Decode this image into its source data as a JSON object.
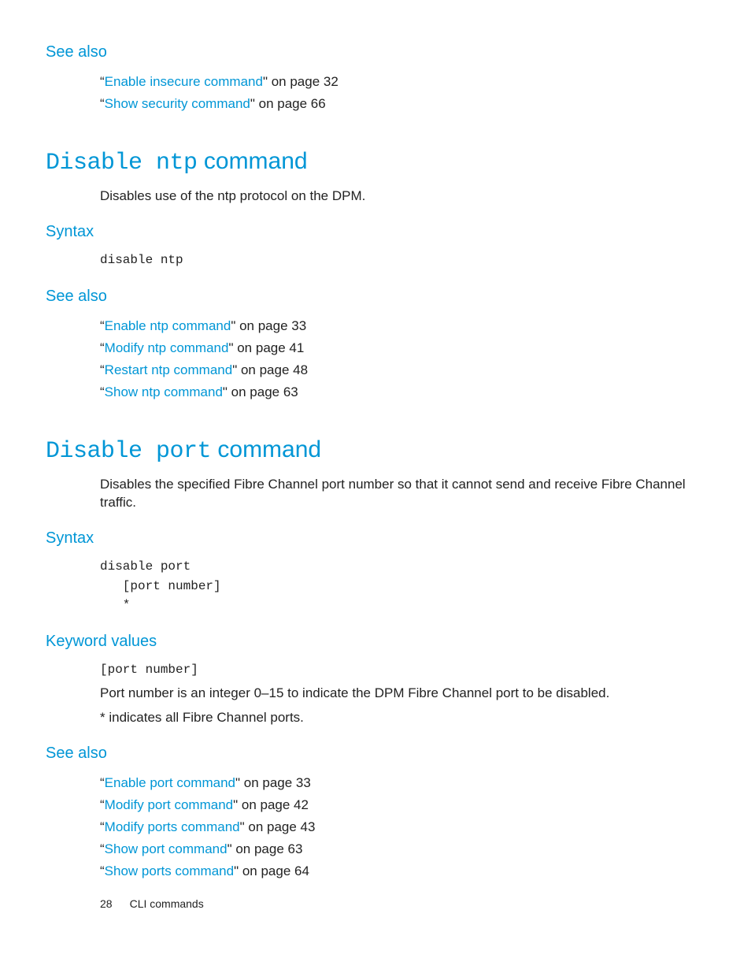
{
  "section1": {
    "heading": "See also",
    "refs": [
      {
        "link": "Enable insecure command",
        "tail": "\" on page 32"
      },
      {
        "link": "Show security command",
        "tail": "\" on page 66"
      }
    ]
  },
  "section2": {
    "titleMono": "Disable ntp",
    "titleRest": " command",
    "desc": "Disables use of the ntp protocol on the DPM.",
    "syntaxHead": "Syntax",
    "syntaxCode": "disable ntp",
    "seeAlsoHead": "See also",
    "refs": [
      {
        "link": "Enable ntp command",
        "tail": "\" on page 33"
      },
      {
        "link": "Modify ntp command",
        "tail": "\" on page 41"
      },
      {
        "link": "Restart ntp command",
        "tail": "\" on page 48"
      },
      {
        "link": "Show ntp command",
        "tail": "\" on page 63"
      }
    ]
  },
  "section3": {
    "titleMono": "Disable port",
    "titleRest": " command",
    "desc": "Disables the specified Fibre Channel port number so that it cannot send and receive Fibre Channel traffic.",
    "syntaxHead": "Syntax",
    "syntaxCode": "disable port\n   [port number]\n   *",
    "kvHead": "Keyword values",
    "kvCode": "[port number]",
    "kvDesc1": "Port number is an integer 0–15 to indicate the DPM Fibre Channel port to be disabled.",
    "kvDesc2": "* indicates all Fibre Channel ports.",
    "seeAlsoHead": "See also",
    "refs": [
      {
        "link": "Enable port command",
        "tail": "\" on page 33"
      },
      {
        "link": "Modify port command",
        "tail": "\" on page 42"
      },
      {
        "link": "Modify ports command",
        "tail": "\" on page 43"
      },
      {
        "link": "Show port command",
        "tail": "\" on page 63"
      },
      {
        "link": "Show ports command",
        "tail": "\" on page 64"
      }
    ]
  },
  "footer": {
    "page": "28",
    "title": "CLI commands"
  },
  "quote": "“"
}
